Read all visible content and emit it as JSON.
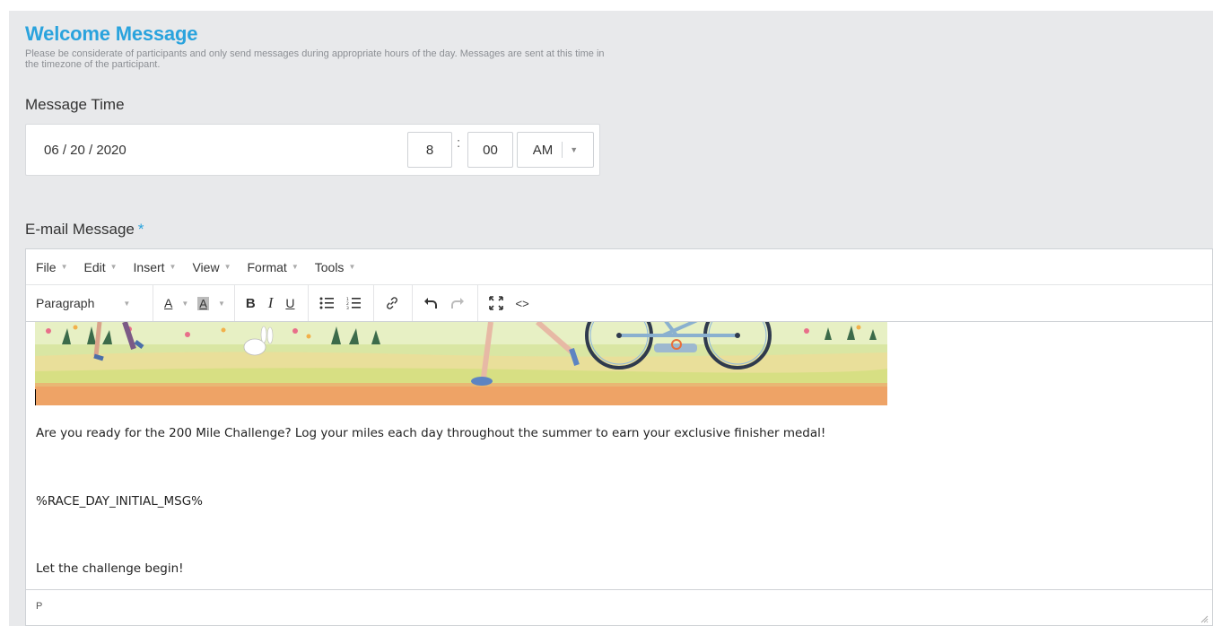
{
  "header": {
    "title": "Welcome Message",
    "subtitle": "Please be considerate of participants and only send messages during appropriate hours of the day. Messages are sent at this time in the timezone of the participant."
  },
  "message_time": {
    "label": "Message Time",
    "date": "06 / 20 / 2020",
    "hour": "8",
    "separator": ":",
    "minute": "00",
    "ampm": "AM"
  },
  "email": {
    "label": "E-mail Message",
    "required_marker": "*",
    "menu": [
      "File",
      "Edit",
      "Insert",
      "View",
      "Format",
      "Tools"
    ],
    "format_select": "Paragraph",
    "toolbar_icons": [
      "text-color-icon",
      "background-color-icon",
      "bold-icon",
      "italic-icon",
      "underline-icon",
      "bullet-list-icon",
      "numbered-list-icon",
      "link-icon",
      "undo-icon",
      "redo-icon",
      "fullscreen-icon",
      "source-code-icon"
    ],
    "body": {
      "p1": "Are you ready for the 200 Mile Challenge? Log your miles each day throughout the summer to earn your exclusive finisher medal!",
      "p2": "%RACE_DAY_INITIAL_MSG%",
      "p3": "Let the challenge begin!"
    },
    "status_path": "P"
  },
  "colors": {
    "accent": "#2aa3dd",
    "panel_bg": "#e8e9eb"
  }
}
